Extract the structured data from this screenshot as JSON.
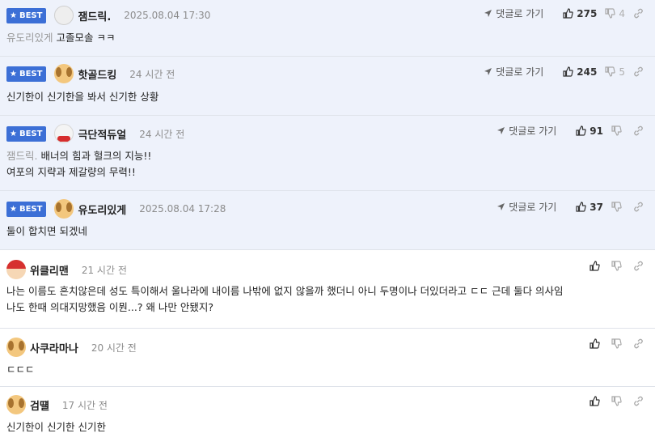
{
  "ui": {
    "best_label": "BEST",
    "reply_label": "댓글로 가기"
  },
  "comments": [
    {
      "best": true,
      "nick": "잼드릭.",
      "time": "2025.08.04 17:30",
      "lines": [
        {
          "ref": "유도리있게",
          "text": "고졸모솔 ㅋㅋ"
        }
      ],
      "up": "275",
      "down": "4"
    },
    {
      "best": true,
      "nick": "핫골드킹",
      "time": "24 시간 전",
      "lines": [
        {
          "text": "신기한이 신기한을 봐서 신기한 상황"
        }
      ],
      "up": "245",
      "down": "5"
    },
    {
      "best": true,
      "nick": "극단적듀얼",
      "time": "24 시간 전",
      "lines": [
        {
          "ref": "잼드릭.",
          "text": "배너의 힘과 헐크의 지능!!"
        },
        {
          "text": "여포의 지략과 제갈량의 무력!!"
        }
      ],
      "up": "91",
      "down": ""
    },
    {
      "best": true,
      "nick": "유도리있게",
      "time": "2025.08.04 17:28",
      "lines": [
        {
          "text": "둘이 합치면 되겠네"
        }
      ],
      "up": "37",
      "down": ""
    },
    {
      "best": false,
      "nick": "위클리맨",
      "time": "21 시간 전",
      "lines": [
        {
          "text": "나는 이름도 흔치않은데 성도 특이해서 울나라에 내이름 나밖에 없지 않을까 했더니 아니 두명이나 더있더라고 ㄷㄷ 근데 둘다 의사임"
        },
        {
          "text": "나도 한때 의대지망했음 이뭔...? 왜 나만 안됐지?"
        }
      ],
      "up": "",
      "down": ""
    },
    {
      "best": false,
      "nick": "사쿠라마나",
      "time": "20 시간 전",
      "lines": [
        {
          "text": "ㄷㄷㄷ"
        }
      ],
      "up": "",
      "down": ""
    },
    {
      "best": false,
      "nick": "검떌",
      "time": "17 시간 전",
      "lines": [
        {
          "text": "신기한이 신기한 신기한"
        }
      ],
      "up": "",
      "down": ""
    }
  ]
}
